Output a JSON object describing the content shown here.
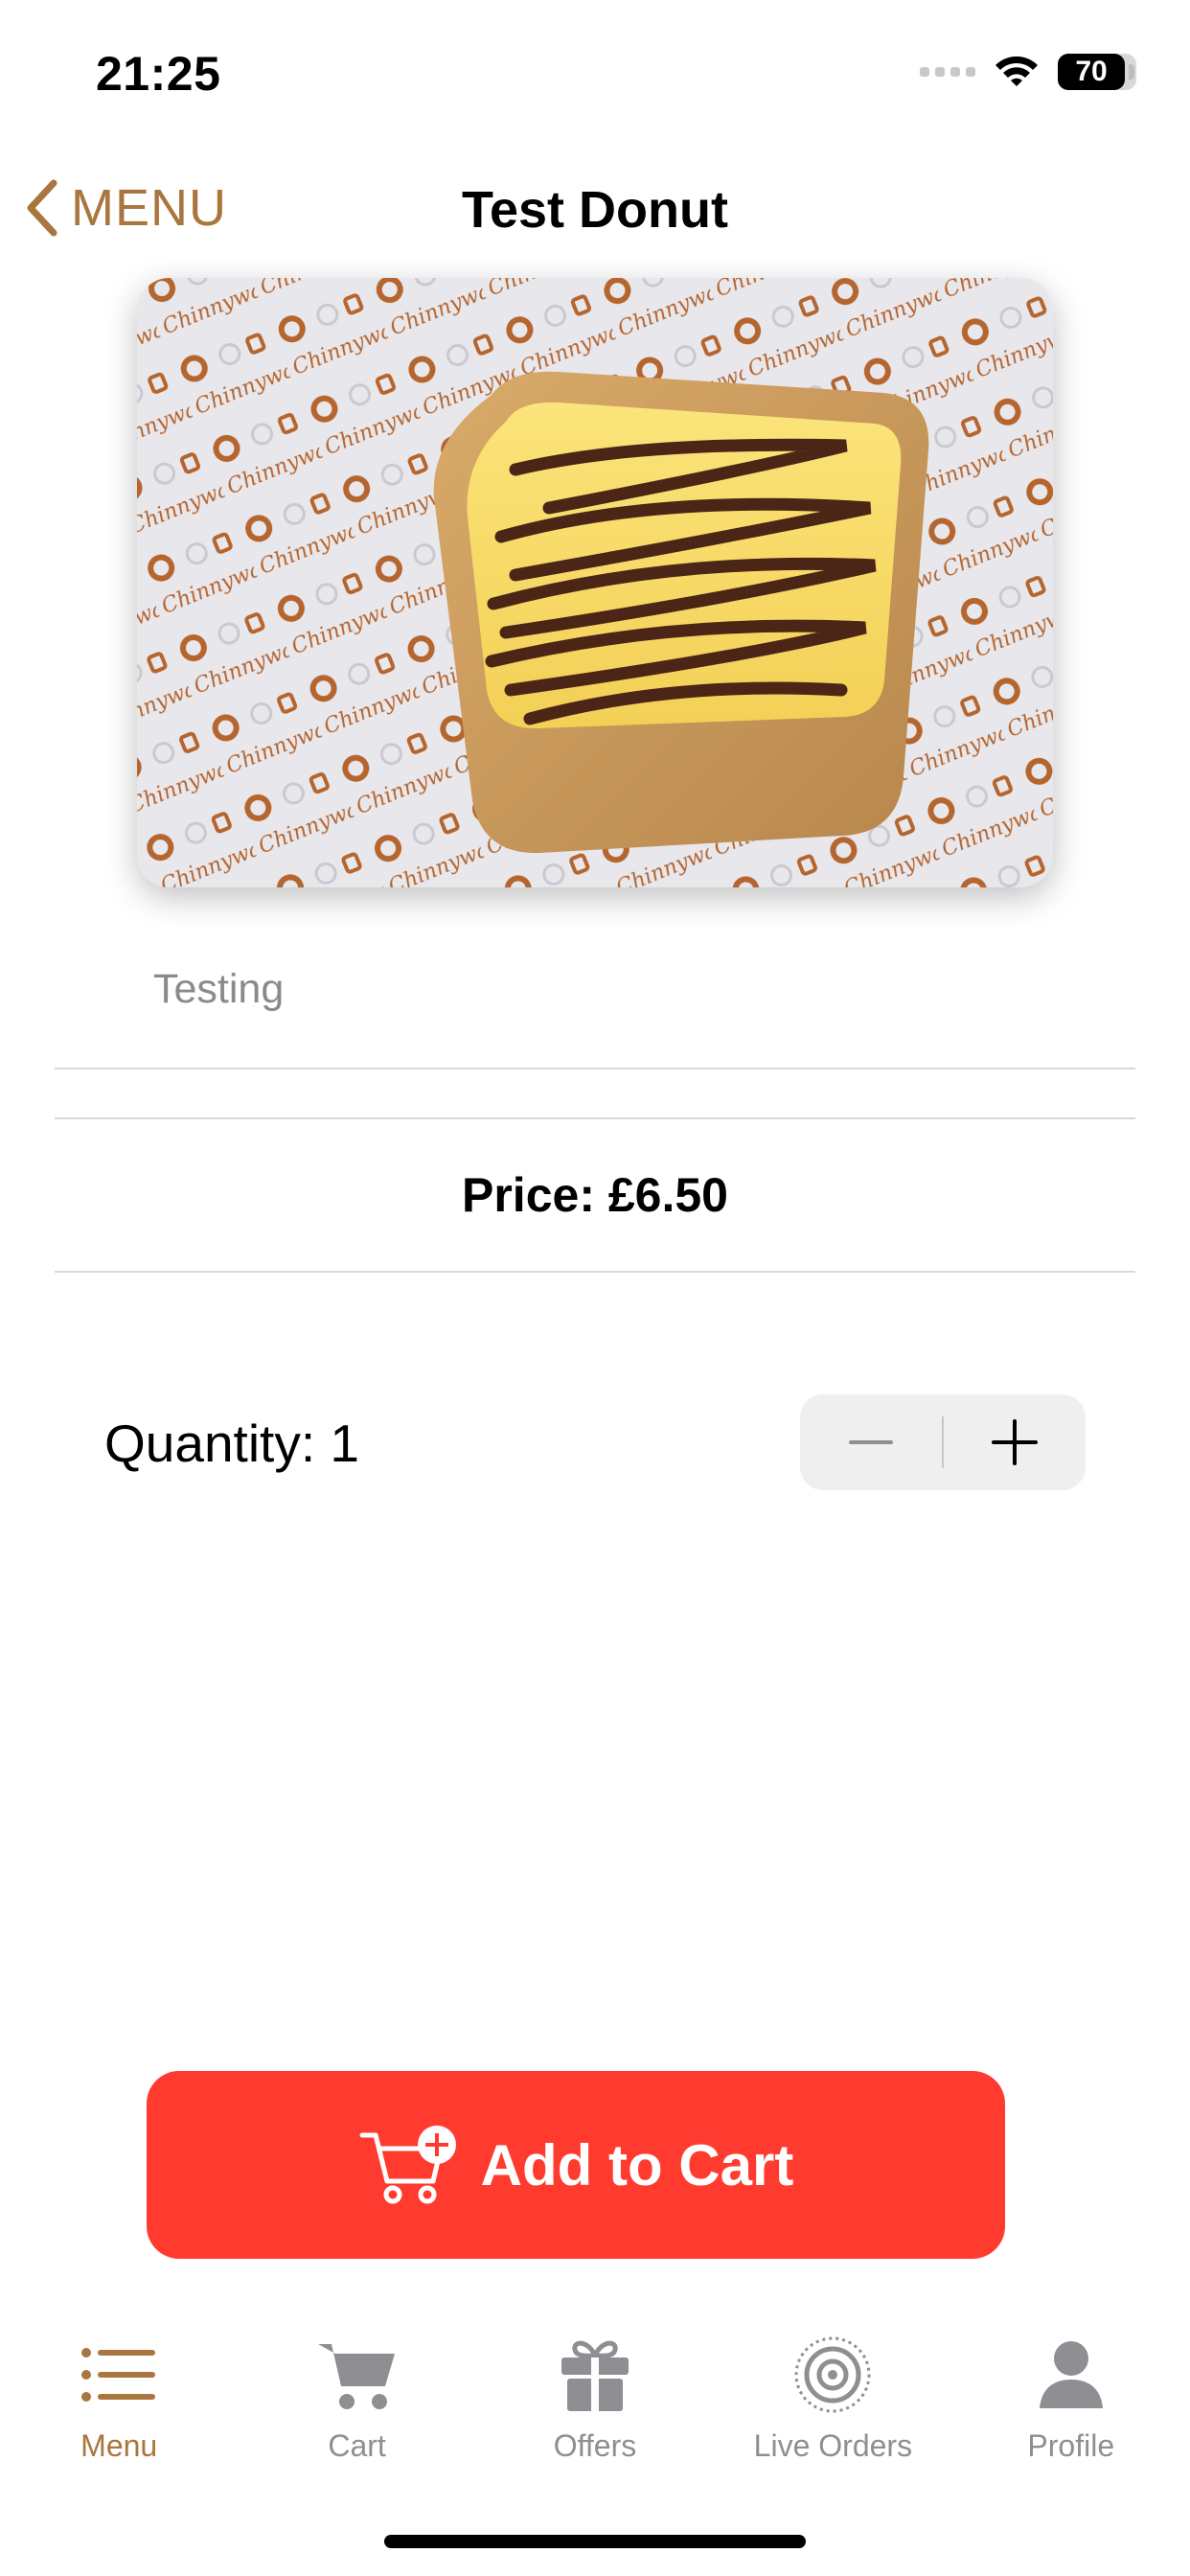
{
  "status_bar": {
    "time": "21:25",
    "battery": "70"
  },
  "nav": {
    "back_label": "MENU",
    "title": "Test Donut"
  },
  "product": {
    "image_alt": "Test Donut",
    "description": "Testing",
    "price": "Price: £6.50",
    "quantity_label": "Quantity: 1"
  },
  "actions": {
    "add_to_cart": "Add to Cart"
  },
  "tabbar": {
    "items": [
      {
        "label": "Menu",
        "icon": "list-icon",
        "active": true
      },
      {
        "label": "Cart",
        "icon": "cart-icon",
        "active": false
      },
      {
        "label": "Offers",
        "icon": "gift-icon",
        "active": false
      },
      {
        "label": "Live Orders",
        "icon": "target-icon",
        "active": false
      },
      {
        "label": "Profile",
        "icon": "person-icon",
        "active": false
      }
    ]
  },
  "colors": {
    "accent": "#a8763e",
    "cta": "#ff3b30",
    "inactive": "#8e8e93"
  }
}
